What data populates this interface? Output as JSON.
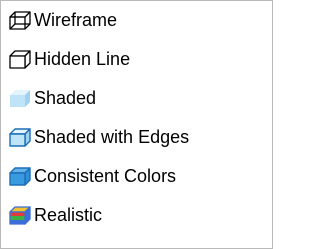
{
  "menu": {
    "items": [
      {
        "label": "Wireframe",
        "icon": "wireframe-box-icon"
      },
      {
        "label": "Hidden Line",
        "icon": "hidden-line-box-icon"
      },
      {
        "label": "Shaded",
        "icon": "shaded-box-icon"
      },
      {
        "label": "Shaded with Edges",
        "icon": "shaded-edges-box-icon"
      },
      {
        "label": "Consistent Colors",
        "icon": "consistent-colors-box-icon"
      },
      {
        "label": "Realistic",
        "icon": "realistic-box-icon"
      }
    ]
  },
  "colors": {
    "border": "#b9b9b9",
    "edge": "#000000",
    "shaded_face": "#bfe3f7",
    "shaded_top": "#e4f4fd",
    "edge_blue": "#1c6fb7",
    "face_blue": "#2f8fd8",
    "top_blue": "#63b3ea",
    "realistic_red": "#e23b3b",
    "realistic_green": "#3cb043",
    "realistic_yellow": "#f2c230",
    "realistic_blue": "#3a6fd8"
  }
}
